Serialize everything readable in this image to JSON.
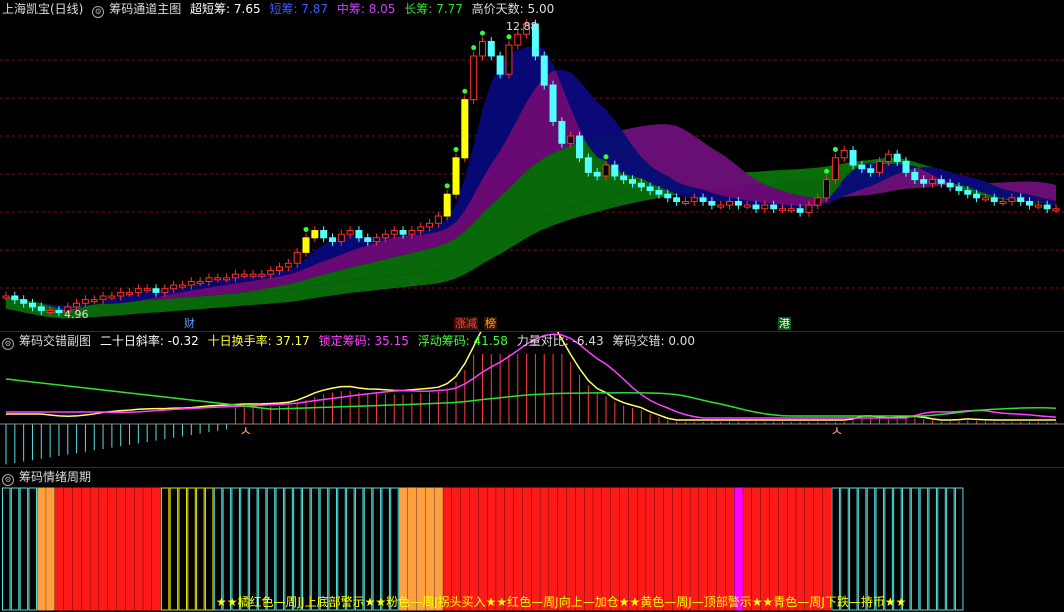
{
  "main_header": {
    "stock": "上海凯宝(日线)",
    "indicator": "筹码通道主图",
    "ultra_short": "超短筹: 7.65",
    "short": "短筹: 7.87",
    "mid": "中筹: 8.05",
    "long": "长筹: 7.77",
    "high_days": "高价天数: 5.00"
  },
  "price_labels": {
    "high": "12.88",
    "low": "4.96"
  },
  "event_tags": {
    "finance": "财",
    "limit": "涨减",
    "list": "榜",
    "hk": "港"
  },
  "sub1_header": {
    "indicator": "筹码交错副图",
    "slope": "二十日斜率: -0.32",
    "turnover": "十日换手率: 37.17",
    "locked": "锁定筹码: 35.15",
    "floating": "浮动筹码: 41.58",
    "power": "力量对比: -6.43",
    "cross": "筹码交错: 0.00"
  },
  "sub2_header": {
    "indicator": "筹码情绪周期"
  },
  "sub2_banner": "★★橘红色—周JJ上底部警示★★粉色—周J拐头买入★★红色—周J向上—加仓★★黄色—周J—顶部警示★★青色—周J下跌—持币★★",
  "colors": {
    "up": "#ff3030",
    "down": "#54ffff",
    "long_band": "#0a6e0a",
    "mid_band": "#6e0a7a",
    "short_band": "#08087a",
    "grid": "#7a1010",
    "phase_red": "#ff1a1a",
    "phase_orange": "#ffa040",
    "phase_yellow": "#e6e600",
    "phase_cyan": "#54e0e0",
    "phase_magenta": "#ff00ff"
  },
  "chart_data": {
    "type": "candlestick",
    "y_reference": {
      "high": 12.88,
      "low": 4.96
    },
    "closes": [
      5.4,
      5.3,
      5.2,
      5.1,
      5.0,
      5.0,
      4.96,
      5.1,
      5.2,
      5.3,
      5.3,
      5.4,
      5.4,
      5.5,
      5.5,
      5.6,
      5.6,
      5.5,
      5.6,
      5.7,
      5.7,
      5.8,
      5.8,
      5.9,
      5.9,
      5.9,
      6.0,
      6.0,
      6.0,
      6.0,
      6.1,
      6.2,
      6.3,
      6.6,
      7.0,
      7.2,
      7.0,
      6.9,
      7.1,
      7.2,
      7.0,
      6.9,
      7.0,
      7.1,
      7.2,
      7.1,
      7.2,
      7.3,
      7.4,
      7.6,
      8.2,
      9.2,
      10.8,
      12.0,
      12.4,
      12.0,
      11.5,
      12.3,
      12.6,
      12.88,
      12.0,
      11.2,
      10.2,
      9.6,
      9.8,
      9.2,
      8.8,
      8.7,
      9.0,
      8.7,
      8.6,
      8.5,
      8.4,
      8.3,
      8.2,
      8.1,
      8.0,
      8.0,
      8.1,
      8.0,
      7.9,
      7.9,
      8.0,
      7.9,
      7.9,
      7.8,
      7.9,
      7.8,
      7.8,
      7.8,
      7.7,
      7.9,
      8.1,
      8.6,
      9.2,
      9.4,
      9.0,
      8.9,
      8.8,
      9.1,
      9.3,
      9.1,
      8.8,
      8.6,
      8.5,
      8.6,
      8.5,
      8.4,
      8.3,
      8.2,
      8.1,
      8.1,
      8.0,
      8.0,
      8.1,
      8.0,
      7.9,
      7.9,
      7.8,
      7.8
    ],
    "phases": [
      "cyan",
      "orange",
      "red",
      "yellow",
      "cyan",
      "orange",
      "red",
      "magenta",
      "red",
      "cyan"
    ]
  }
}
